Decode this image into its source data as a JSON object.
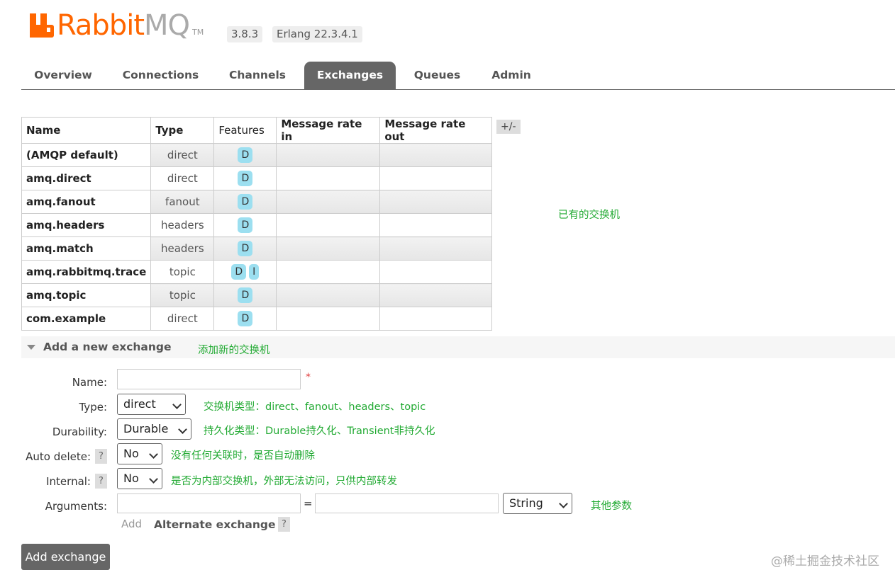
{
  "header": {
    "logo_text_a": "Rabbit",
    "logo_text_b": "MQ",
    "tm": "TM",
    "version": "3.8.3",
    "erlang": "Erlang 22.3.4.1"
  },
  "tabs": [
    "Overview",
    "Connections",
    "Channels",
    "Exchanges",
    "Queues",
    "Admin"
  ],
  "active_tab": "Exchanges",
  "table": {
    "headers": [
      "Name",
      "Type",
      "Features",
      "Message rate in",
      "Message rate out"
    ],
    "plus_minus": "+/-",
    "rows": [
      {
        "name": "(AMQP default)",
        "type": "direct",
        "features": [
          "D"
        ]
      },
      {
        "name": "amq.direct",
        "type": "direct",
        "features": [
          "D"
        ]
      },
      {
        "name": "amq.fanout",
        "type": "fanout",
        "features": [
          "D"
        ]
      },
      {
        "name": "amq.headers",
        "type": "headers",
        "features": [
          "D"
        ]
      },
      {
        "name": "amq.match",
        "type": "headers",
        "features": [
          "D"
        ]
      },
      {
        "name": "amq.rabbitmq.trace",
        "type": "topic",
        "features": [
          "D",
          "I"
        ]
      },
      {
        "name": "amq.topic",
        "type": "topic",
        "features": [
          "D"
        ]
      },
      {
        "name": "com.example",
        "type": "direct",
        "features": [
          "D"
        ]
      }
    ]
  },
  "annotations": {
    "existing": "已有的交换机",
    "add_new": "添加新的交换机",
    "type": "交换机类型：direct、fanout、headers、topic",
    "durability": "持久化类型：Durable持久化、Transient非持久化",
    "auto_delete": "没有任何关联时，是否自动删除",
    "internal": "是否为内部交换机，外部无法访问，只供内部转发",
    "arguments": "其他参数"
  },
  "form": {
    "section_title": "Add a new exchange",
    "name_label": "Name:",
    "required": "*",
    "type_label": "Type:",
    "type_value": "direct",
    "durability_label": "Durability:",
    "durability_value": "Durable",
    "auto_delete_label": "Auto delete:",
    "auto_delete_value": "No",
    "internal_label": "Internal:",
    "internal_value": "No",
    "arguments_label": "Arguments:",
    "equals": "=",
    "arg_type_value": "String",
    "add_link": "Add",
    "alternate_exchange": "Alternate exchange",
    "help": "?",
    "submit": "Add exchange"
  },
  "watermark": "@稀土掘金技术社区",
  "colors": {
    "brand": "#ff6600",
    "tab_active": "#666666",
    "annotation": "#22aa33",
    "badge": "#9cdff0"
  }
}
